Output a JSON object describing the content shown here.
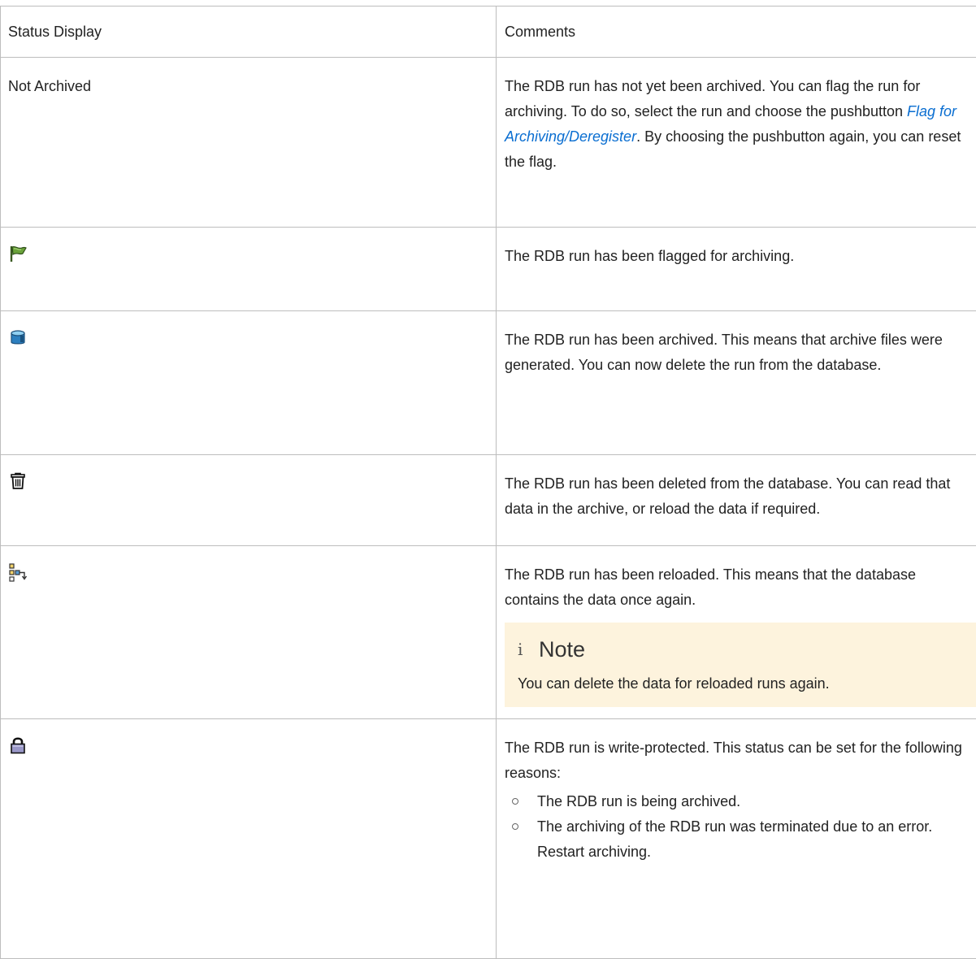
{
  "table": {
    "headers": [
      "Status Display",
      "Comments"
    ],
    "rows": {
      "not_archived": {
        "status_text": "Not Archived",
        "comment_before": "The RDB run has not yet been archived. You can flag the run for archiving. To do so, select the run and choose the push­button ",
        "comment_link": "Flag for Archiving/Deregister",
        "comment_after": ". By choosing the push­button again, you can reset the flag."
      },
      "flagged": {
        "status_icon": "green-flag-icon",
        "comment": "The RDB run has been flagged for archiving."
      },
      "archived": {
        "status_icon": "database-cylinder-icon",
        "comment": "The RDB run has been archived. This means that archive files were generated. You can now delete the run from the database."
      },
      "deleted": {
        "status_icon": "trash-can-icon",
        "comment": "The RDB run has been deleted from the database. You can read that data in the archive, or reload the data if required."
      },
      "reloaded": {
        "status_icon": "reload-hierarchy-icon",
        "comment": "The RDB run has been reloaded. This means that the data­base contains the data once again.",
        "note_icon": "i",
        "note_title": "Note",
        "note_text": "You can delete the data for reloaded runs again."
      },
      "write_protected": {
        "status_icon": "padlock-icon",
        "comment": "The RDB run is write-protected. This status can be set for the following reasons:",
        "reasons": [
          "The RDB run is being archived.",
          "The archiving of the RDB run was terminated due to an error. Restart archiving."
        ]
      }
    }
  },
  "colors": {
    "border": "#bdbdbd",
    "link": "#0a6ed1",
    "note_background": "#fdf3dd"
  }
}
